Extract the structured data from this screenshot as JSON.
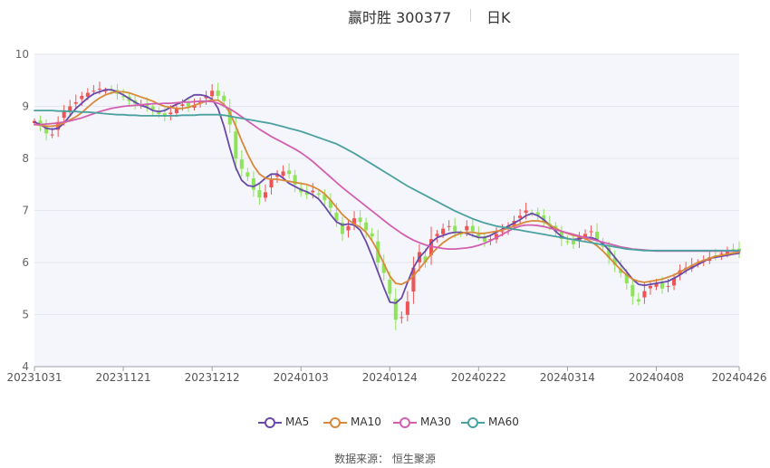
{
  "header": {
    "title": "赢时胜 300377",
    "period": "日K"
  },
  "source": "数据来源： 恒生聚源",
  "colors": {
    "up": "#f05454",
    "down": "#8fe35a",
    "grid": "#e3e6ee",
    "plot_bg": "#f5f6fb"
  },
  "chart_data": {
    "type": "candlestick",
    "title": "赢时胜 300377 日K",
    "y_ticks": [
      4,
      5,
      6,
      7,
      8,
      9,
      10
    ],
    "ylim": [
      4,
      10
    ],
    "x_tick_labels": [
      "20231031",
      "20231121",
      "20231212",
      "20240103",
      "20240124",
      "20240222",
      "20240314",
      "20240408",
      "20240426"
    ],
    "grid": "horizontal",
    "legend_position": "bottom",
    "dates": [
      "20231031",
      "20231101",
      "20231102",
      "20231103",
      "20231106",
      "20231107",
      "20231108",
      "20231109",
      "20231110",
      "20231113",
      "20231114",
      "20231115",
      "20231116",
      "20231117",
      "20231120",
      "20231121",
      "20231122",
      "20231123",
      "20231124",
      "20231127",
      "20231128",
      "20231129",
      "20231130",
      "20231201",
      "20231204",
      "20231205",
      "20231206",
      "20231207",
      "20231208",
      "20231211",
      "20231212",
      "20231213",
      "20231214",
      "20231215",
      "20231218",
      "20231219",
      "20231220",
      "20231221",
      "20231222",
      "20231225",
      "20231226",
      "20231227",
      "20231228",
      "20231229",
      "20240102",
      "20240103",
      "20240104",
      "20240105",
      "20240108",
      "20240109",
      "20240110",
      "20240111",
      "20240112",
      "20240115",
      "20240116",
      "20240117",
      "20240118",
      "20240119",
      "20240122",
      "20240123",
      "20240124",
      "20240125",
      "20240126",
      "20240129",
      "20240130",
      "20240131",
      "20240201",
      "20240202",
      "20240205",
      "20240206",
      "20240207",
      "20240208",
      "20240219",
      "20240220",
      "20240221",
      "20240222",
      "20240223",
      "20240226",
      "20240227",
      "20240228",
      "20240229",
      "20240301",
      "20240304",
      "20240305",
      "20240306",
      "20240307",
      "20240308",
      "20240311",
      "20240312",
      "20240313",
      "20240314",
      "20240315",
      "20240318",
      "20240319",
      "20240320",
      "20240321",
      "20240322",
      "20240325",
      "20240326",
      "20240327",
      "20240328",
      "20240329",
      "20240401",
      "20240402",
      "20240403",
      "20240408",
      "20240409",
      "20240410",
      "20240411",
      "20240412",
      "20240415",
      "20240416",
      "20240417",
      "20240418",
      "20240419",
      "20240422",
      "20240423",
      "20240424",
      "20240425",
      "20240426"
    ],
    "closes": [
      8.72,
      8.62,
      8.48,
      8.46,
      8.7,
      8.9,
      9.0,
      9.08,
      9.2,
      9.26,
      9.3,
      9.34,
      9.3,
      9.3,
      9.24,
      9.18,
      9.1,
      9.05,
      9.02,
      8.98,
      8.94,
      8.85,
      8.8,
      8.88,
      8.96,
      9.04,
      9.0,
      9.02,
      9.1,
      9.2,
      9.3,
      9.2,
      9.1,
      8.65,
      8.0,
      7.8,
      7.65,
      7.4,
      7.25,
      7.35,
      7.6,
      7.68,
      7.75,
      7.7,
      7.5,
      7.35,
      7.3,
      7.38,
      7.3,
      7.2,
      7.05,
      6.8,
      6.55,
      6.7,
      6.85,
      6.78,
      6.62,
      6.5,
      6.0,
      5.8,
      5.4,
      4.9,
      4.95,
      5.25,
      5.9,
      6.2,
      6.0,
      6.45,
      6.55,
      6.65,
      6.7,
      6.6,
      6.55,
      6.7,
      6.6,
      6.5,
      6.4,
      6.45,
      6.55,
      6.6,
      6.7,
      6.8,
      6.9,
      7.0,
      6.95,
      6.9,
      6.8,
      6.7,
      6.6,
      6.45,
      6.4,
      6.35,
      6.5,
      6.55,
      6.6,
      6.45,
      6.3,
      6.1,
      5.95,
      5.8,
      5.6,
      5.35,
      5.25,
      5.45,
      5.55,
      5.6,
      5.5,
      5.55,
      5.7,
      5.85,
      5.9,
      5.95,
      6.0,
      6.05,
      6.1,
      6.12,
      6.18,
      6.22,
      6.25,
      6.2
    ],
    "series": [
      {
        "name": "MA5",
        "color": "#6a4aa8",
        "values": [
          8.7,
          8.65,
          8.58,
          8.56,
          8.58,
          8.68,
          8.82,
          8.96,
          9.06,
          9.16,
          9.24,
          9.28,
          9.32,
          9.32,
          9.28,
          9.22,
          9.15,
          9.08,
          9.02,
          8.98,
          8.92,
          8.9,
          8.92,
          8.98,
          9.04,
          9.08,
          9.16,
          9.22,
          9.22,
          9.2,
          9.14,
          8.96,
          8.62,
          8.2,
          7.82,
          7.58,
          7.48,
          7.46,
          7.52,
          7.62,
          7.7,
          7.7,
          7.62,
          7.52,
          7.46,
          7.4,
          7.36,
          7.3,
          7.22,
          7.08,
          6.92,
          6.78,
          6.72,
          6.74,
          6.72,
          6.62,
          6.4,
          6.12,
          5.82,
          5.52,
          5.24,
          5.22,
          5.32,
          5.62,
          5.9,
          6.1,
          6.22,
          6.38,
          6.48,
          6.52,
          6.56,
          6.58,
          6.58,
          6.56,
          6.52,
          6.48,
          6.48,
          6.52,
          6.58,
          6.64,
          6.7,
          6.76,
          6.82,
          6.9,
          6.94,
          6.9,
          6.82,
          6.72,
          6.6,
          6.5,
          6.46,
          6.44,
          6.46,
          6.48,
          6.48,
          6.44,
          6.36,
          6.24,
          6.1,
          5.96,
          5.82,
          5.68,
          5.58,
          5.56,
          5.58,
          5.6,
          5.62,
          5.64,
          5.7,
          5.76,
          5.84,
          5.9,
          5.96,
          6.02,
          6.08,
          6.1,
          6.12,
          6.14,
          6.16,
          6.18
        ]
      },
      {
        "name": "MA10",
        "color": "#d9893a",
        "values": [
          8.65,
          8.64,
          8.62,
          8.62,
          8.64,
          8.68,
          8.74,
          8.8,
          8.88,
          8.98,
          9.08,
          9.16,
          9.22,
          9.26,
          9.28,
          9.28,
          9.26,
          9.22,
          9.18,
          9.14,
          9.1,
          9.04,
          9.0,
          8.98,
          8.96,
          8.96,
          8.98,
          9.02,
          9.06,
          9.1,
          9.12,
          9.12,
          9.04,
          8.88,
          8.62,
          8.34,
          8.08,
          7.86,
          7.7,
          7.62,
          7.6,
          7.6,
          7.58,
          7.56,
          7.54,
          7.52,
          7.5,
          7.46,
          7.4,
          7.32,
          7.2,
          7.06,
          6.92,
          6.82,
          6.74,
          6.68,
          6.58,
          6.42,
          6.22,
          5.98,
          5.74,
          5.6,
          5.58,
          5.64,
          5.74,
          5.88,
          6.02,
          6.16,
          6.28,
          6.38,
          6.46,
          6.52,
          6.56,
          6.58,
          6.58,
          6.56,
          6.56,
          6.58,
          6.6,
          6.62,
          6.66,
          6.7,
          6.74,
          6.78,
          6.8,
          6.8,
          6.78,
          6.72,
          6.66,
          6.6,
          6.56,
          6.52,
          6.5,
          6.46,
          6.4,
          6.32,
          6.22,
          6.1,
          5.98,
          5.86,
          5.76,
          5.68,
          5.64,
          5.62,
          5.64,
          5.66,
          5.68,
          5.72,
          5.76,
          5.82,
          5.88,
          5.94,
          6.0,
          6.04,
          6.08,
          6.12,
          6.14,
          6.16,
          6.18,
          6.2
        ]
      },
      {
        "name": "MA30",
        "color": "#d35fb0",
        "values": [
          8.65,
          8.65,
          8.66,
          8.67,
          8.68,
          8.7,
          8.72,
          8.75,
          8.78,
          8.82,
          8.86,
          8.9,
          8.93,
          8.96,
          8.98,
          9.0,
          9.01,
          9.02,
          9.03,
          9.04,
          9.05,
          9.05,
          9.06,
          9.06,
          9.07,
          9.08,
          9.08,
          9.09,
          9.1,
          9.1,
          9.09,
          9.06,
          9.01,
          8.95,
          8.88,
          8.8,
          8.72,
          8.64,
          8.56,
          8.49,
          8.42,
          8.36,
          8.3,
          8.24,
          8.18,
          8.11,
          8.03,
          7.94,
          7.84,
          7.74,
          7.64,
          7.54,
          7.44,
          7.35,
          7.26,
          7.17,
          7.08,
          6.99,
          6.9,
          6.81,
          6.72,
          6.64,
          6.56,
          6.49,
          6.43,
          6.38,
          6.34,
          6.31,
          6.29,
          6.27,
          6.26,
          6.26,
          6.27,
          6.28,
          6.3,
          6.33,
          6.37,
          6.42,
          6.48,
          6.54,
          6.6,
          6.66,
          6.7,
          6.72,
          6.72,
          6.71,
          6.69,
          6.66,
          6.63,
          6.6,
          6.57,
          6.54,
          6.51,
          6.48,
          6.45,
          6.42,
          6.39,
          6.36,
          6.33,
          6.3,
          6.28,
          6.26,
          6.25,
          6.24,
          6.23,
          6.22,
          6.22,
          6.22,
          6.22,
          6.22,
          6.22,
          6.22,
          6.22,
          6.22,
          6.22,
          6.22,
          6.22,
          6.22,
          6.22,
          6.22
        ]
      },
      {
        "name": "MA60",
        "color": "#4aa1a0",
        "values": [
          8.92,
          8.92,
          8.92,
          8.92,
          8.91,
          8.91,
          8.9,
          8.9,
          8.89,
          8.89,
          8.88,
          8.87,
          8.86,
          8.85,
          8.84,
          8.84,
          8.83,
          8.83,
          8.82,
          8.82,
          8.82,
          8.82,
          8.82,
          8.82,
          8.82,
          8.83,
          8.83,
          8.83,
          8.84,
          8.84,
          8.84,
          8.84,
          8.83,
          8.81,
          8.79,
          8.77,
          8.75,
          8.73,
          8.71,
          8.69,
          8.67,
          8.64,
          8.61,
          8.58,
          8.55,
          8.52,
          8.48,
          8.44,
          8.4,
          8.36,
          8.32,
          8.28,
          8.22,
          8.16,
          8.1,
          8.03,
          7.96,
          7.89,
          7.82,
          7.75,
          7.68,
          7.61,
          7.54,
          7.47,
          7.41,
          7.35,
          7.29,
          7.23,
          7.17,
          7.11,
          7.05,
          6.99,
          6.94,
          6.89,
          6.84,
          6.8,
          6.76,
          6.73,
          6.7,
          6.68,
          6.66,
          6.64,
          6.62,
          6.6,
          6.58,
          6.56,
          6.54,
          6.52,
          6.5,
          6.48,
          6.46,
          6.44,
          6.42,
          6.4,
          6.38,
          6.36,
          6.34,
          6.32,
          6.3,
          6.28,
          6.26,
          6.25,
          6.24,
          6.23,
          6.23,
          6.23,
          6.23,
          6.23,
          6.23,
          6.23,
          6.23,
          6.23,
          6.23,
          6.23,
          6.23,
          6.23,
          6.23,
          6.23,
          6.23,
          6.23
        ]
      }
    ]
  }
}
